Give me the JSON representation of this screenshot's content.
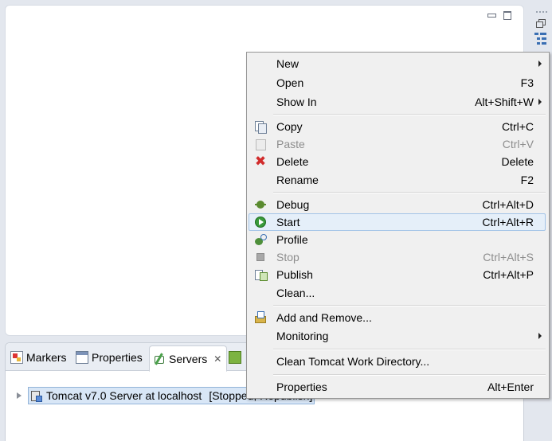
{
  "panel_tabs": [
    {
      "label": "Markers"
    },
    {
      "label": "Properties"
    },
    {
      "label": "Servers"
    }
  ],
  "servers_tree": {
    "server_label": "Tomcat v7.0 Server at localhost",
    "server_state": "[Stopped, Republish]"
  },
  "context_menu": {
    "new": {
      "label": "New"
    },
    "open": {
      "label": "Open",
      "shortcut": "F3"
    },
    "show_in": {
      "label": "Show In",
      "shortcut": "Alt+Shift+W"
    },
    "copy": {
      "label": "Copy",
      "shortcut": "Ctrl+C"
    },
    "paste": {
      "label": "Paste",
      "shortcut": "Ctrl+V"
    },
    "delete": {
      "label": "Delete",
      "shortcut": "Delete"
    },
    "rename": {
      "label": "Rename",
      "shortcut": "F2"
    },
    "debug": {
      "label": "Debug",
      "shortcut": "Ctrl+Alt+D"
    },
    "start": {
      "label": "Start",
      "shortcut": "Ctrl+Alt+R"
    },
    "profile": {
      "label": "Profile"
    },
    "stop": {
      "label": "Stop",
      "shortcut": "Ctrl+Alt+S"
    },
    "publish": {
      "label": "Publish",
      "shortcut": "Ctrl+Alt+P"
    },
    "clean": {
      "label": "Clean..."
    },
    "add_remove": {
      "label": "Add and Remove..."
    },
    "monitoring": {
      "label": "Monitoring"
    },
    "clean_work_dir": {
      "label": "Clean Tomcat Work Directory..."
    },
    "properties": {
      "label": "Properties",
      "shortcut": "Alt+Enter"
    }
  },
  "colors": {
    "hover_bg": "#e5eff9",
    "hover_border": "#a3c4e8",
    "selection_bg": "#d8e6f6",
    "disabled_text": "#8d8d8d"
  }
}
